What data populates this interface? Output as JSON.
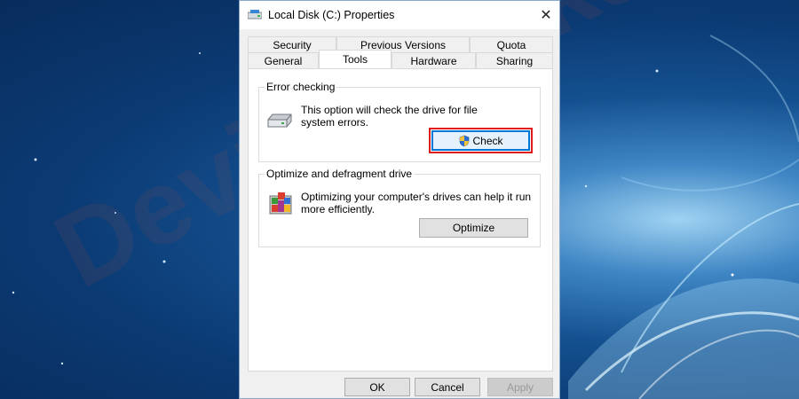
{
  "window": {
    "title": "Local Disk (C:) Properties",
    "close_glyph": "✕"
  },
  "tabs": {
    "row1": [
      "Security",
      "Previous Versions",
      "Quota"
    ],
    "row2": [
      "General",
      "Tools",
      "Hardware",
      "Sharing"
    ],
    "active": "Tools"
  },
  "error_checking": {
    "title": "Error checking",
    "description_line1": "This option will check the drive for file",
    "description_line2": "system errors.",
    "button_label": "Check",
    "icon": "drive-icon"
  },
  "optimize": {
    "title": "Optimize and defragment drive",
    "description_line1": "Optimizing your computer's drives can help it run",
    "description_line2": "more efficiently.",
    "button_label": "Optimize",
    "icon": "defrag-icon"
  },
  "footer": {
    "ok": "OK",
    "cancel": "Cancel",
    "apply": "Apply"
  },
  "highlight_color": "#e01b1b",
  "wallpaper_watermark": "DeviceTricks"
}
